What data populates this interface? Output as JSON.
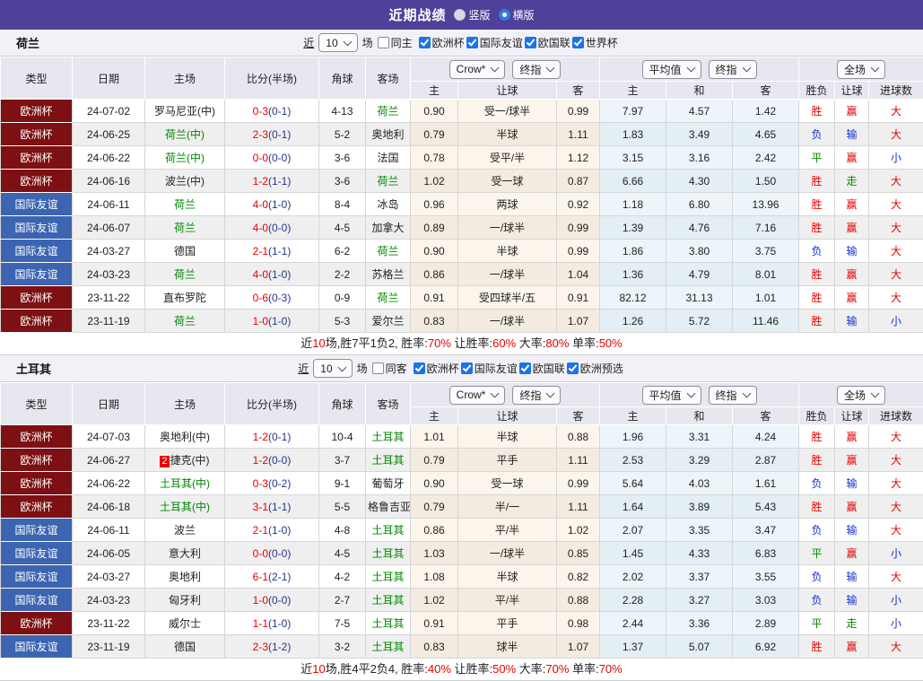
{
  "meta": {
    "topbar_color": "#4F4099",
    "team_color": "#008800",
    "league_colors": {
      "欧洲杯": "#7D1013",
      "国际友谊": "#3C64B1"
    },
    "value_colors": {
      "胜": "#E60000",
      "平": "#008800",
      "负": "#1430CC",
      "赢": "#E60000",
      "走": "#008800",
      "输": "#1430CC",
      "大": "#E60000",
      "小": "#1430CC"
    }
  },
  "titlebar": {
    "title": "近期战绩",
    "vertical": "竖版",
    "horizontal": "横版"
  },
  "sections": [
    {
      "team": "荷兰",
      "filter": {
        "near": "近",
        "count": "10",
        "games": "场",
        "same": "同主",
        "same_checked": false,
        "leagues": [
          "欧洲杯",
          "国际友谊",
          "欧国联",
          "世界杯"
        ]
      },
      "controls": {
        "bookmaker": "Crow*",
        "final1": "终指",
        "average": "平均值",
        "final2": "终指",
        "scope": "全场"
      },
      "head": {
        "type": "类型",
        "date": "日期",
        "home": "主场",
        "score": "比分(半场)",
        "corner": "角球",
        "away": "客场",
        "asia_home": "主",
        "asia_handicap": "让球",
        "asia_away": "客",
        "eu_home": "主",
        "eu_draw": "和",
        "eu_away": "客",
        "res_wdl": "胜负",
        "res_handicap": "让球",
        "res_goals": "进球数"
      },
      "rows": [
        {
          "league": "欧洲杯",
          "date": "24-07-02",
          "home": "罗马尼亚(中)",
          "home_team": false,
          "ft": "0-3",
          "ht": "(0-1)",
          "corner": "4-13",
          "away": "荷兰",
          "away_team": true,
          "asia": [
            "0.90",
            "受一/球半",
            "0.99"
          ],
          "eu": [
            "7.97",
            "4.57",
            "1.42"
          ],
          "res": [
            "胜",
            "赢",
            "大"
          ]
        },
        {
          "league": "欧洲杯",
          "date": "24-06-25",
          "home": "荷兰(中)",
          "home_team": true,
          "ft": "2-3",
          "ht": "(0-1)",
          "corner": "5-2",
          "away": "奥地利",
          "away_team": false,
          "asia": [
            "0.79",
            "半球",
            "1.11"
          ],
          "eu": [
            "1.83",
            "3.49",
            "4.65"
          ],
          "res": [
            "负",
            "输",
            "大"
          ]
        },
        {
          "league": "欧洲杯",
          "date": "24-06-22",
          "home": "荷兰(中)",
          "home_team": true,
          "ft": "0-0",
          "ht": "(0-0)",
          "corner": "3-6",
          "away": "法国",
          "away_team": false,
          "asia": [
            "0.78",
            "受平/半",
            "1.12"
          ],
          "eu": [
            "3.15",
            "3.16",
            "2.42"
          ],
          "res": [
            "平",
            "赢",
            "小"
          ]
        },
        {
          "league": "欧洲杯",
          "date": "24-06-16",
          "home": "波兰(中)",
          "home_team": false,
          "ft": "1-2",
          "ht": "(1-1)",
          "corner": "3-6",
          "away": "荷兰",
          "away_team": true,
          "asia": [
            "1.02",
            "受一球",
            "0.87"
          ],
          "eu": [
            "6.66",
            "4.30",
            "1.50"
          ],
          "res": [
            "胜",
            "走",
            "大"
          ]
        },
        {
          "league": "国际友谊",
          "date": "24-06-11",
          "home": "荷兰",
          "home_team": true,
          "ft": "4-0",
          "ht": "(1-0)",
          "corner": "8-4",
          "away": "冰岛",
          "away_team": false,
          "asia": [
            "0.96",
            "两球",
            "0.92"
          ],
          "eu": [
            "1.18",
            "6.80",
            "13.96"
          ],
          "res": [
            "胜",
            "赢",
            "大"
          ]
        },
        {
          "league": "国际友谊",
          "date": "24-06-07",
          "home": "荷兰",
          "home_team": true,
          "ft": "4-0",
          "ht": "(0-0)",
          "corner": "4-5",
          "away": "加拿大",
          "away_team": false,
          "asia": [
            "0.89",
            "一/球半",
            "0.99"
          ],
          "eu": [
            "1.39",
            "4.76",
            "7.16"
          ],
          "res": [
            "胜",
            "赢",
            "大"
          ]
        },
        {
          "league": "国际友谊",
          "date": "24-03-27",
          "home": "德国",
          "home_team": false,
          "ft": "2-1",
          "ht": "(1-1)",
          "corner": "6-2",
          "away": "荷兰",
          "away_team": true,
          "asia": [
            "0.90",
            "半球",
            "0.99"
          ],
          "eu": [
            "1.86",
            "3.80",
            "3.75"
          ],
          "res": [
            "负",
            "输",
            "大"
          ]
        },
        {
          "league": "国际友谊",
          "date": "24-03-23",
          "home": "荷兰",
          "home_team": true,
          "ft": "4-0",
          "ht": "(1-0)",
          "corner": "2-2",
          "away": "苏格兰",
          "away_team": false,
          "asia": [
            "0.86",
            "一/球半",
            "1.04"
          ],
          "eu": [
            "1.36",
            "4.79",
            "8.01"
          ],
          "res": [
            "胜",
            "赢",
            "大"
          ]
        },
        {
          "league": "欧洲杯",
          "date": "23-11-22",
          "home": "直布罗陀",
          "home_team": false,
          "ft": "0-6",
          "ht": "(0-3)",
          "corner": "0-9",
          "away": "荷兰",
          "away_team": true,
          "asia": [
            "0.91",
            "受四球半/五",
            "0.91"
          ],
          "eu": [
            "82.12",
            "31.13",
            "1.01"
          ],
          "res": [
            "胜",
            "赢",
            "大"
          ]
        },
        {
          "league": "欧洲杯",
          "date": "23-11-19",
          "home": "荷兰",
          "home_team": true,
          "ft": "1-0",
          "ht": "(1-0)",
          "corner": "5-3",
          "away": "爱尔兰",
          "away_team": false,
          "asia": [
            "0.83",
            "一/球半",
            "1.07"
          ],
          "eu": [
            "1.26",
            "5.72",
            "11.46"
          ],
          "res": [
            "胜",
            "输",
            "小"
          ]
        }
      ],
      "summary": [
        {
          "t": "近"
        },
        {
          "t": "10",
          "red": true
        },
        {
          "t": "场,胜7平1负2, 胜率:"
        },
        {
          "t": "70%",
          "red": true
        },
        {
          "t": " 让胜率:"
        },
        {
          "t": "60%",
          "red": true
        },
        {
          "t": " 大率:"
        },
        {
          "t": "80%",
          "red": true
        },
        {
          "t": " 单率:"
        },
        {
          "t": "50%",
          "red": true
        }
      ]
    },
    {
      "team": "土耳其",
      "filter": {
        "near": "近",
        "count": "10",
        "games": "场",
        "same": "同客",
        "same_checked": false,
        "leagues": [
          "欧洲杯",
          "国际友谊",
          "欧国联",
          "欧洲预选"
        ]
      },
      "controls": {
        "bookmaker": "Crow*",
        "final1": "终指",
        "average": "平均值",
        "final2": "终指",
        "scope": "全场"
      },
      "head": {
        "type": "类型",
        "date": "日期",
        "home": "主场",
        "score": "比分(半场)",
        "corner": "角球",
        "away": "客场",
        "asia_home": "主",
        "asia_handicap": "让球",
        "asia_away": "客",
        "eu_home": "主",
        "eu_draw": "和",
        "eu_away": "客",
        "res_wdl": "胜负",
        "res_handicap": "让球",
        "res_goals": "进球数"
      },
      "rows": [
        {
          "league": "欧洲杯",
          "date": "24-07-03",
          "home": "奥地利(中)",
          "home_team": false,
          "ft": "1-2",
          "ht": "(0-1)",
          "corner": "10-4",
          "away": "土耳其",
          "away_team": true,
          "asia": [
            "1.01",
            "半球",
            "0.88"
          ],
          "eu": [
            "1.96",
            "3.31",
            "4.24"
          ],
          "res": [
            "胜",
            "赢",
            "大"
          ]
        },
        {
          "league": "欧洲杯",
          "date": "24-06-27",
          "home": "捷克(中)",
          "home_team": false,
          "badge": "2",
          "ft": "1-2",
          "ht": "(0-0)",
          "corner": "3-7",
          "away": "土耳其",
          "away_team": true,
          "asia": [
            "0.79",
            "平手",
            "1.11"
          ],
          "eu": [
            "2.53",
            "3.29",
            "2.87"
          ],
          "res": [
            "胜",
            "赢",
            "大"
          ]
        },
        {
          "league": "欧洲杯",
          "date": "24-06-22",
          "home": "土耳其(中)",
          "home_team": true,
          "ft": "0-3",
          "ht": "(0-2)",
          "corner": "9-1",
          "away": "葡萄牙",
          "away_team": false,
          "asia": [
            "0.90",
            "受一球",
            "0.99"
          ],
          "eu": [
            "5.64",
            "4.03",
            "1.61"
          ],
          "res": [
            "负",
            "输",
            "大"
          ]
        },
        {
          "league": "欧洲杯",
          "date": "24-06-18",
          "home": "土耳其(中)",
          "home_team": true,
          "ft": "3-1",
          "ht": "(1-1)",
          "corner": "5-5",
          "away": "格鲁吉亚",
          "away_team": false,
          "asia": [
            "0.79",
            "半/一",
            "1.11"
          ],
          "eu": [
            "1.64",
            "3.89",
            "5.43"
          ],
          "res": [
            "胜",
            "赢",
            "大"
          ]
        },
        {
          "league": "国际友谊",
          "date": "24-06-11",
          "home": "波兰",
          "home_team": false,
          "ft": "2-1",
          "ht": "(1-0)",
          "corner": "4-8",
          "away": "土耳其",
          "away_team": true,
          "asia": [
            "0.86",
            "平/半",
            "1.02"
          ],
          "eu": [
            "2.07",
            "3.35",
            "3.47"
          ],
          "res": [
            "负",
            "输",
            "大"
          ]
        },
        {
          "league": "国际友谊",
          "date": "24-06-05",
          "home": "意大利",
          "home_team": false,
          "ft": "0-0",
          "ht": "(0-0)",
          "corner": "4-5",
          "away": "土耳其",
          "away_team": true,
          "asia": [
            "1.03",
            "一/球半",
            "0.85"
          ],
          "eu": [
            "1.45",
            "4.33",
            "6.83"
          ],
          "res": [
            "平",
            "赢",
            "小"
          ]
        },
        {
          "league": "国际友谊",
          "date": "24-03-27",
          "home": "奥地利",
          "home_team": false,
          "ft": "6-1",
          "ht": "(2-1)",
          "corner": "4-2",
          "away": "土耳其",
          "away_team": true,
          "asia": [
            "1.08",
            "半球",
            "0.82"
          ],
          "eu": [
            "2.02",
            "3.37",
            "3.55"
          ],
          "res": [
            "负",
            "输",
            "大"
          ]
        },
        {
          "league": "国际友谊",
          "date": "24-03-23",
          "home": "匈牙利",
          "home_team": false,
          "ft": "1-0",
          "ht": "(0-0)",
          "corner": "2-7",
          "away": "土耳其",
          "away_team": true,
          "asia": [
            "1.02",
            "平/半",
            "0.88"
          ],
          "eu": [
            "2.28",
            "3.27",
            "3.03"
          ],
          "res": [
            "负",
            "输",
            "小"
          ]
        },
        {
          "league": "欧洲杯",
          "date": "23-11-22",
          "home": "威尔士",
          "home_team": false,
          "ft": "1-1",
          "ht": "(1-0)",
          "corner": "7-5",
          "away": "土耳其",
          "away_team": true,
          "asia": [
            "0.91",
            "平手",
            "0.98"
          ],
          "eu": [
            "2.44",
            "3.36",
            "2.89"
          ],
          "res": [
            "平",
            "走",
            "小"
          ]
        },
        {
          "league": "国际友谊",
          "date": "23-11-19",
          "home": "德国",
          "home_team": false,
          "ft": "2-3",
          "ht": "(1-2)",
          "corner": "3-2",
          "away": "土耳其",
          "away_team": true,
          "asia": [
            "0.83",
            "球半",
            "1.07"
          ],
          "eu": [
            "1.37",
            "5.07",
            "6.92"
          ],
          "res": [
            "胜",
            "赢",
            "大"
          ]
        }
      ],
      "summary": [
        {
          "t": "近"
        },
        {
          "t": "10",
          "red": true
        },
        {
          "t": "场,胜4平2负4, 胜率:"
        },
        {
          "t": "40%",
          "red": true
        },
        {
          "t": " 让胜率:"
        },
        {
          "t": "50%",
          "red": true
        },
        {
          "t": " 大率:"
        },
        {
          "t": "70%",
          "red": true
        },
        {
          "t": " 单率:"
        },
        {
          "t": "70%",
          "red": true
        }
      ]
    }
  ]
}
